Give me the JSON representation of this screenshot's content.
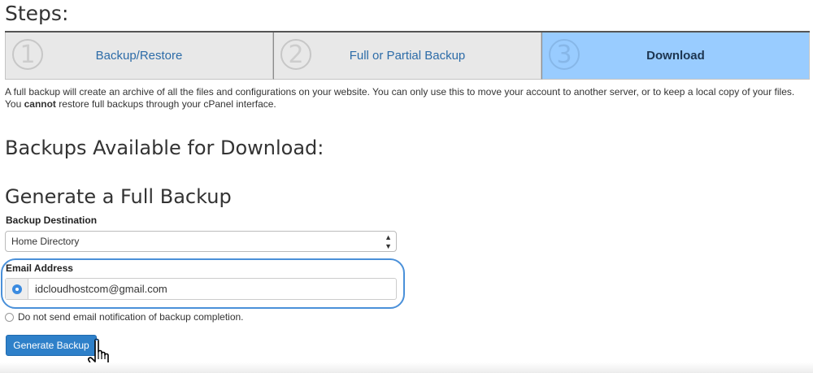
{
  "steps": {
    "title": "Steps:",
    "items": [
      {
        "number": "1",
        "label": "Backup/Restore",
        "active": false
      },
      {
        "number": "2",
        "label": "Full or Partial Backup",
        "active": false
      },
      {
        "number": "3",
        "label": "Download",
        "active": true
      }
    ]
  },
  "description": {
    "line1": "A full backup will create an archive of all the files and configurations on your website. You can only use this to move your account to another server, or to keep a local copy of your files.",
    "line2_prefix": "You ",
    "line2_bold": "cannot",
    "line2_suffix": " restore full backups through your cPanel interface."
  },
  "backups_heading": "Backups Available for Download:",
  "generate": {
    "heading": "Generate a Full Backup",
    "destination_label": "Backup Destination",
    "destination_value": "Home Directory",
    "email_label": "Email Address",
    "email_value": "idcloudhostcom@gmail.com",
    "no_email_label": "Do not send email notification of backup completion.",
    "button_label": "Generate Backup"
  },
  "colors": {
    "active_step": "#99ccff",
    "button": "#2e80c9",
    "highlight": "#4a90d9"
  }
}
